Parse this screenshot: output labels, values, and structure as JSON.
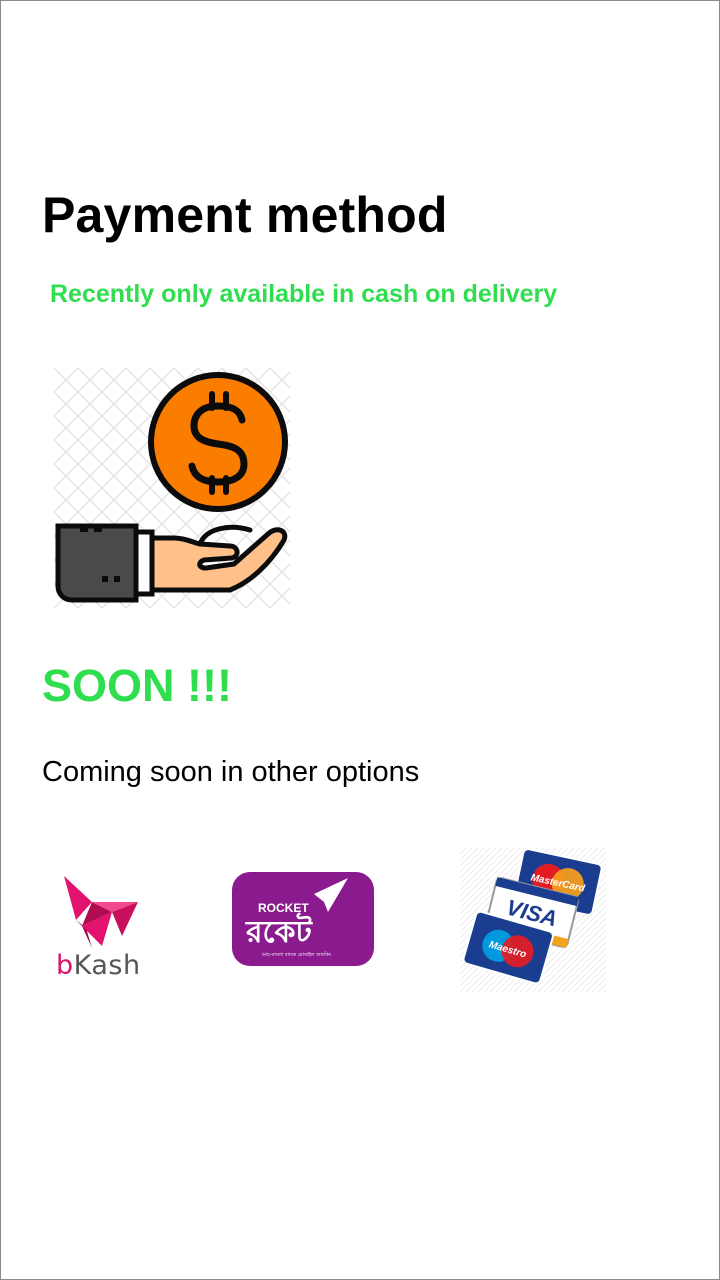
{
  "page": {
    "title": "Payment method",
    "subtitle": "Recently only available in cash on delivery",
    "status_heading": "SOON !!!",
    "coming_text": "Coming soon in other options"
  },
  "hero": {
    "icon": "hand-with-dollar-coin-icon"
  },
  "logos": {
    "bkash": {
      "text_b": "b",
      "text_rest": "Kash"
    },
    "rocket": {
      "label": "ROCKET",
      "script": "রকেট",
      "tagline": "ডাচ-বাংলা ব্যাংক মোবাইল ব্যাংকিং"
    },
    "cards": {
      "mastercard": "MasterCard",
      "visa": "VISA",
      "maestro": "Maestro"
    }
  },
  "colors": {
    "accent_green": "#2ede4f",
    "coin_orange": "#fb7d00",
    "sleeve_gray": "#4a4a4a",
    "skin": "#ffc08a",
    "bkash_pink": "#d8136b",
    "rocket_purple": "#8a1a8e"
  }
}
